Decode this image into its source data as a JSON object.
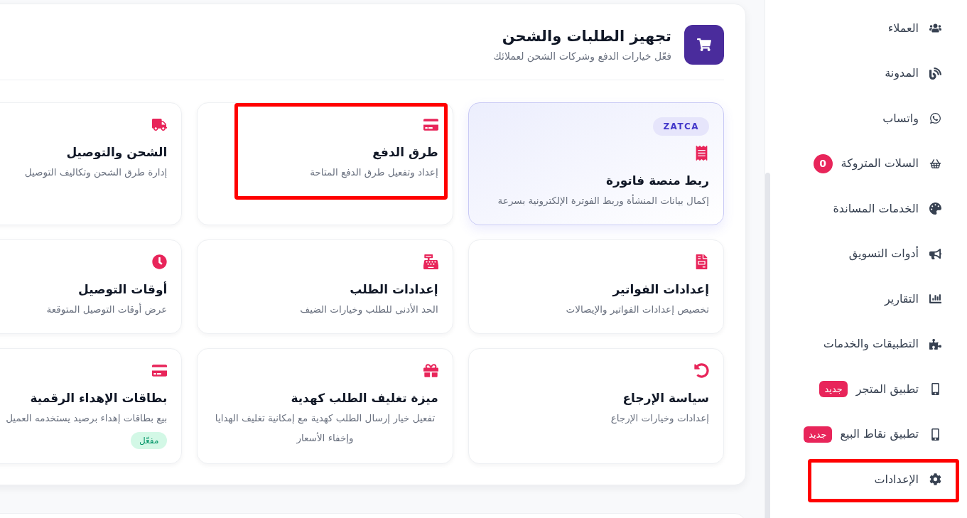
{
  "sidebar": {
    "items": [
      {
        "label": "العملاء",
        "highlighted": false
      },
      {
        "label": "المدونة",
        "highlighted": false
      },
      {
        "label": "واتساب",
        "highlighted": false
      },
      {
        "label": "السلات المتروكة",
        "highlighted": false,
        "badge": {
          "kind": "count",
          "text": "0"
        }
      },
      {
        "label": "الخدمات المساندة",
        "highlighted": false
      },
      {
        "label": "أدوات التسويق",
        "highlighted": false
      },
      {
        "label": "التقارير",
        "highlighted": false
      },
      {
        "label": "التطبيقات والخدمات",
        "highlighted": false
      },
      {
        "label": "تطبيق المتجر",
        "highlighted": false,
        "badge": {
          "kind": "new",
          "text": "جديد"
        }
      },
      {
        "label": "تطبيق نقاط البيع",
        "highlighted": false,
        "badge": {
          "kind": "new",
          "text": "جديد"
        }
      },
      {
        "label": "الإعدادات",
        "highlighted": true
      }
    ]
  },
  "section": {
    "title": "تجهيز الطلبات والشحن",
    "subtitle": "فعّل خيارات الدفع وشركات الشحن لعملائك",
    "cards": [
      {
        "tag": "ZATCA",
        "title": "ربط منصة فاتورة",
        "description": "إكمال بيانات المنشأة وربط الفوترة الإلكترونية بسرعة",
        "featured": true,
        "highlighted": false
      },
      {
        "title": "طرق الدفع",
        "description": "إعداد وتفعيل طرق الدفع المتاحة",
        "featured": false,
        "highlighted": true
      },
      {
        "title": "الشحن والتوصيل",
        "description": "إدارة طرق الشحن وتكاليف التوصيل",
        "featured": false,
        "highlighted": false
      },
      {
        "title": "إعدادات الفواتير",
        "description": "تخصيص إعدادات الفواتير والإيصالات",
        "featured": false,
        "highlighted": false
      },
      {
        "title": "إعدادات الطلب",
        "description": "الحد الأدنى للطلب وخيارات الضيف",
        "featured": false,
        "highlighted": false
      },
      {
        "title": "أوقات التوصيل",
        "description": "عرض أوقات التوصيل المتوقعة",
        "featured": false,
        "highlighted": false
      },
      {
        "title": "سياسة الإرجاع",
        "description": "إعدادات وخيارات الإرجاع",
        "featured": false,
        "highlighted": false
      },
      {
        "title": "ميزة تغليف الطلب كهدية",
        "description": "تفعيل خيار إرسال الطلب كهدية مع إمكانية تغليف الهدايا وإخفاء الأسعار",
        "featured": false,
        "highlighted": false
      },
      {
        "title": "بطاقات الإهداء الرقمية",
        "description": "بيع بطاقات إهداء برصيد يستخدمه العميل",
        "status": "مفعّل",
        "featured": false,
        "highlighted": false
      }
    ]
  }
}
